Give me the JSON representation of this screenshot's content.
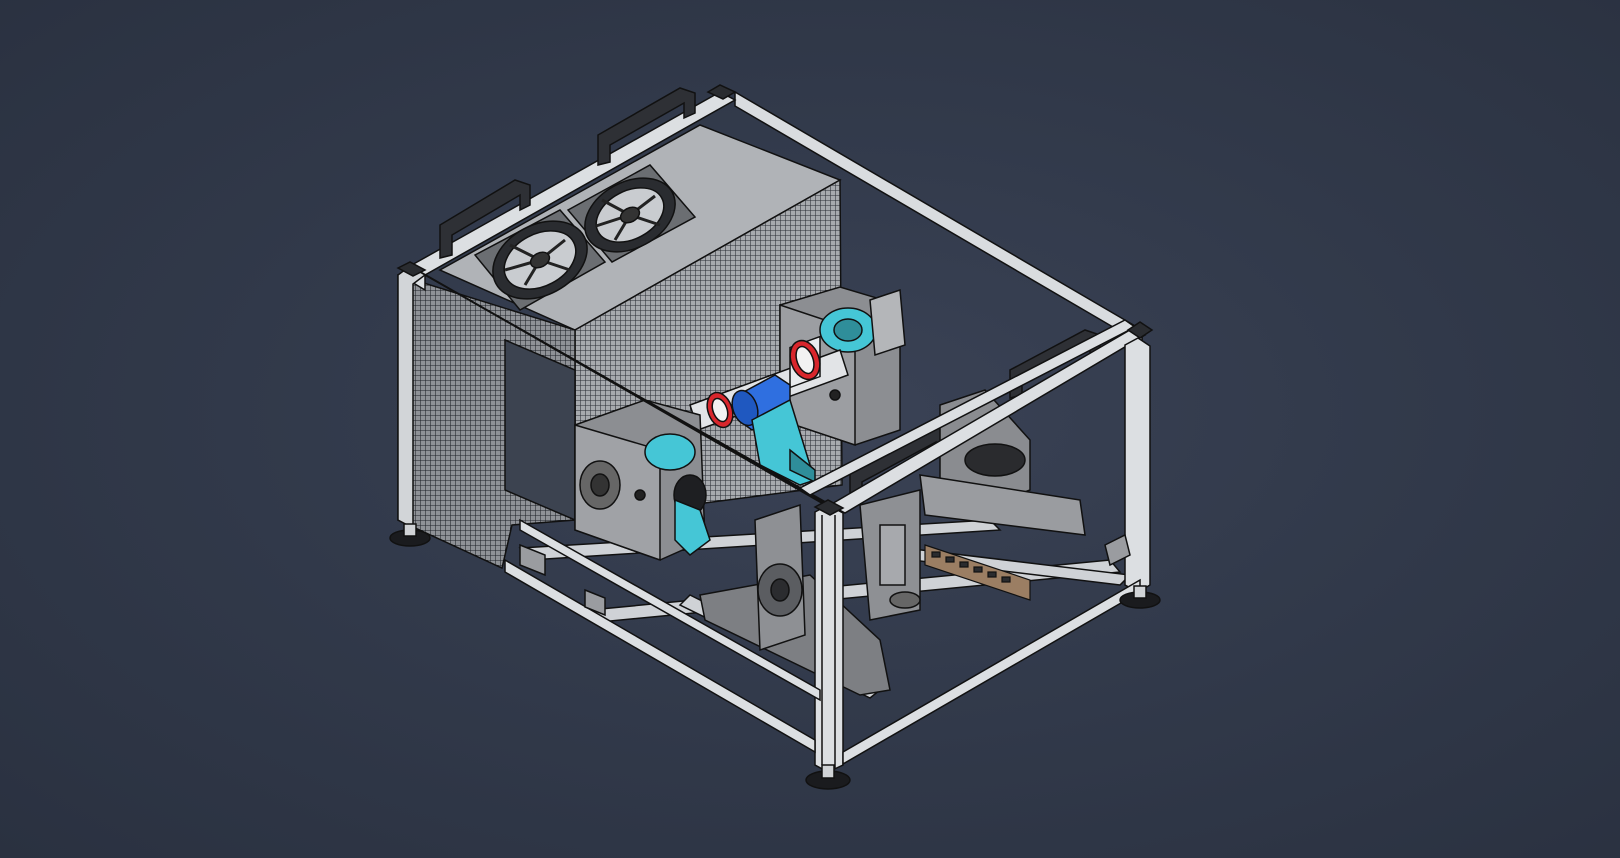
{
  "viewport": {
    "background_color": "#323a4b",
    "view_mode": "shaded-with-edges",
    "projection": "isometric"
  },
  "model": {
    "frame_color": "#d9dcdf",
    "mesh_panel_color": "#9a9da2",
    "bracket_color": "#8e9094",
    "accent_blue": "#2f6fe0",
    "accent_cyan": "#45c6d6",
    "coupling_red": "#d8262c",
    "parts": [
      {
        "id": "frame",
        "icon": "extrusion-frame-icon"
      },
      {
        "id": "mesh-enclosure",
        "icon": "mesh-panel-icon"
      },
      {
        "id": "fan-left",
        "icon": "fan-icon"
      },
      {
        "id": "fan-right",
        "icon": "fan-icon"
      },
      {
        "id": "handles",
        "icon": "handle-icon"
      },
      {
        "id": "shaft-assembly",
        "icon": "shaft-icon"
      },
      {
        "id": "torque-sensor",
        "icon": "sensor-icon"
      },
      {
        "id": "leveling-feet",
        "icon": "foot-icon"
      }
    ]
  }
}
